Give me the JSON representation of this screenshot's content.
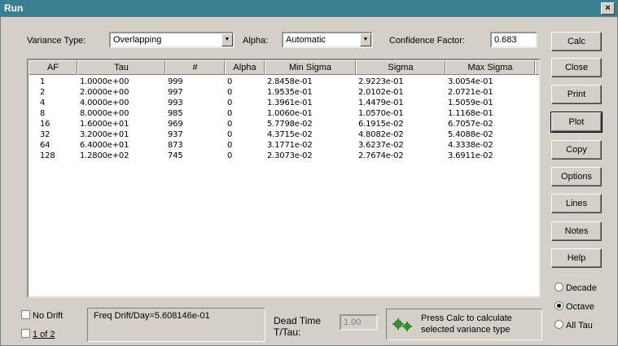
{
  "window": {
    "title": "Run",
    "close_glyph": "×"
  },
  "controls": {
    "variance_type_label": "Variance Type:",
    "variance_type_value": "Overlapping",
    "alpha_label": "Alpha:",
    "alpha_value": "Automatic",
    "confidence_label": "Confidence Factor:",
    "confidence_value": "0.683"
  },
  "table": {
    "headers": [
      "AF",
      "Tau",
      "#",
      "Alpha",
      "Min Sigma",
      "Sigma",
      "Max Sigma"
    ],
    "rows": [
      [
        "1",
        "1.0000e+00",
        "999",
        "0",
        "2.8458e-01",
        "2.9223e-01",
        "3.0054e-01"
      ],
      [
        "2",
        "2.0000e+00",
        "997",
        "0",
        "1.9535e-01",
        "2.0102e-01",
        "2.0721e-01"
      ],
      [
        "4",
        "4.0000e+00",
        "993",
        "0",
        "1.3961e-01",
        "1.4479e-01",
        "1.5059e-01"
      ],
      [
        "8",
        "8.0000e+00",
        "985",
        "0",
        "1.0060e-01",
        "1.0570e-01",
        "1.1168e-01"
      ],
      [
        "16",
        "1.6000e+01",
        "969",
        "0",
        "5.7798e-02",
        "6.1915e-02",
        "6.7057e-02"
      ],
      [
        "32",
        "3.2000e+01",
        "937",
        "0",
        "4.3715e-02",
        "4.8082e-02",
        "5.4088e-02"
      ],
      [
        "64",
        "6.4000e+01",
        "873",
        "0",
        "3.1771e-02",
        "3.6237e-02",
        "4.3338e-02"
      ],
      [
        "128",
        "1.2800e+02",
        "745",
        "0",
        "2.3073e-02",
        "2.7674e-02",
        "3.6911e-02"
      ]
    ]
  },
  "buttons": [
    "Calc",
    "Close",
    "Print",
    "Plot",
    "Copy",
    "Options",
    "Lines",
    "Notes",
    "Help"
  ],
  "radios": [
    {
      "label": "Decade",
      "checked": false
    },
    {
      "label": "Octave",
      "checked": true
    },
    {
      "label": "All Tau",
      "checked": false
    }
  ],
  "bottom": {
    "no_drift_label": "No Drift",
    "one_of_two_label": "1 of 2",
    "freq_drift_text": "Freq Drift/Day=5.608146e-01",
    "dead_time_label_1": "Dead Time",
    "dead_time_label_2": "T/Tau:",
    "dead_time_value": "1.00",
    "status_line_1": "Press Calc to calculate",
    "status_line_2": "selected variance type",
    "status_icon": "gears-icon"
  }
}
